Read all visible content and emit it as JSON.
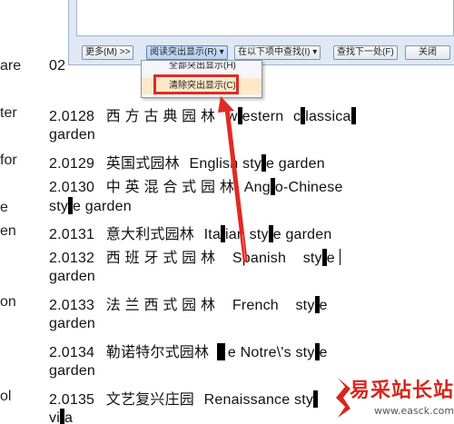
{
  "left_column": [
    "are",
    "ter",
    "for",
    "e",
    "en",
    "on",
    "ol"
  ],
  "toolbar": {
    "more": "更多(M) >>",
    "reading_highlight": "阅读突出显示(R) ▾",
    "find_in": "在以下项中查找(I) ▾",
    "find_next": "查找下一处(F)",
    "close": "关闭"
  },
  "menu": {
    "highlight_all": "全部突出显示(H)",
    "clear_highlight": "清除突出显示(C)"
  },
  "doc": {
    "top_code": "02",
    "lines": [
      {
        "code": "2.0128",
        "cn": "西 方 古 典 园 林",
        "en_a": "w",
        "en_b": "estern",
        "en_c": "c",
        "en_d": "lassica"
      },
      {
        "text": "garden"
      },
      {
        "code": "2.0129",
        "cn": "英国式园林",
        "en_a": "English sty",
        "en_b": "e garden"
      },
      {
        "code": "2.0130",
        "cn": "中 英 混 合 式 园 林",
        "en_a": "Ang",
        "en_b": "o-Chinese"
      },
      {
        "pre": "sty",
        "post": "e garden"
      },
      {
        "code": "2.0131",
        "cn": "意大利式园林",
        "en_a": "Ita",
        "en_b": "ian sty",
        "en_c": "e garden"
      },
      {
        "code": "2.0132",
        "cn": "西 班 牙 式 园 林",
        "en_a": "Spanish    sty",
        "en_b": "e"
      },
      {
        "text": "garden"
      },
      {
        "code": "2.0133",
        "cn": "法 兰 西 式 园 林",
        "en_a": "French    sty",
        "en_b": "e"
      },
      {
        "text": "garden"
      },
      {
        "code": "2.0134",
        "cn": "勒诺特尔式园林",
        "en_a": "e Notre\\'s sty",
        "en_b": "e"
      },
      {
        "text": "garden"
      },
      {
        "code": "2.0135",
        "cn": "文艺复兴庄园",
        "en_a": "Renaissance sty"
      },
      {
        "pre": "vi",
        "post": "a"
      }
    ]
  },
  "watermark": {
    "cn": "易采站长站",
    "en": "www.easck.com"
  },
  "colors": {
    "annotation_red": "#e12a25",
    "highlight": "#000000",
    "dialog_bg": "#dfe8f3"
  }
}
